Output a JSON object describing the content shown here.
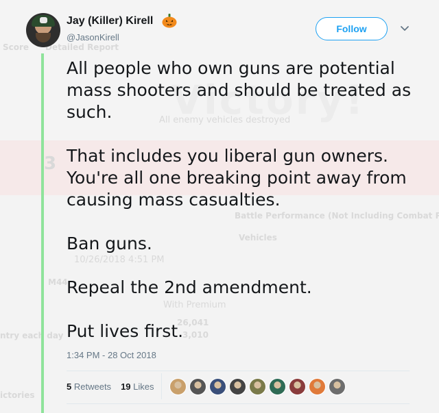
{
  "background": {
    "title_text": "Victory!",
    "subtitle": "All enemy vehicles destroyed",
    "score_tab": "Score",
    "report_tab": "Detailed Report",
    "rank": "3",
    "performance_header": "Battle Performance (Not Including Combat Reserve",
    "vehicles_label": "Vehicles",
    "date_text": "10/26/2018 4:51 PM",
    "tank_name": "M44",
    "premium_label": "With Premium",
    "credits": "26,041",
    "xp": "3,010",
    "left_note": "ntry each day",
    "victories_label": "ictories",
    "accent_colors": {
      "top_band": "#f4f4f4",
      "red_band": "#f6e9e9",
      "green_rule": "#8fe39b"
    }
  },
  "tweet": {
    "display_name": "Jay (Killer) Kirell",
    "handle": "@JasonKirell",
    "follow_label": "Follow",
    "icons": {
      "name_emoji": "jack-o-lantern-icon",
      "menu": "chevron-down-icon"
    },
    "paragraphs": [
      [
        "All people who own guns are potential",
        "mass shooters and should be treated as",
        "such."
      ],
      [
        "That includes you liberal gun owners.",
        "You're all one breaking point away from",
        "causing mass casualties."
      ],
      [
        "Ban guns."
      ],
      [
        "Repeal the 2nd amendment."
      ],
      [
        "Put lives first."
      ]
    ],
    "timestamp": "1:34 PM - 28 Oct 2018",
    "retweets_count": "5",
    "retweets_label": "Retweets",
    "likes_count": "19",
    "likes_label": "Likes",
    "liker_avatar_colors": [
      "#c9a06b",
      "#555555",
      "#3a4f7a",
      "#444444",
      "#7a7a4a",
      "#2f6b55",
      "#8a3c3c",
      "#e07a3a",
      "#6d6d6d"
    ],
    "colors": {
      "accent": "#1da1f2",
      "text": "#14171a",
      "secondary": "#657786"
    }
  }
}
